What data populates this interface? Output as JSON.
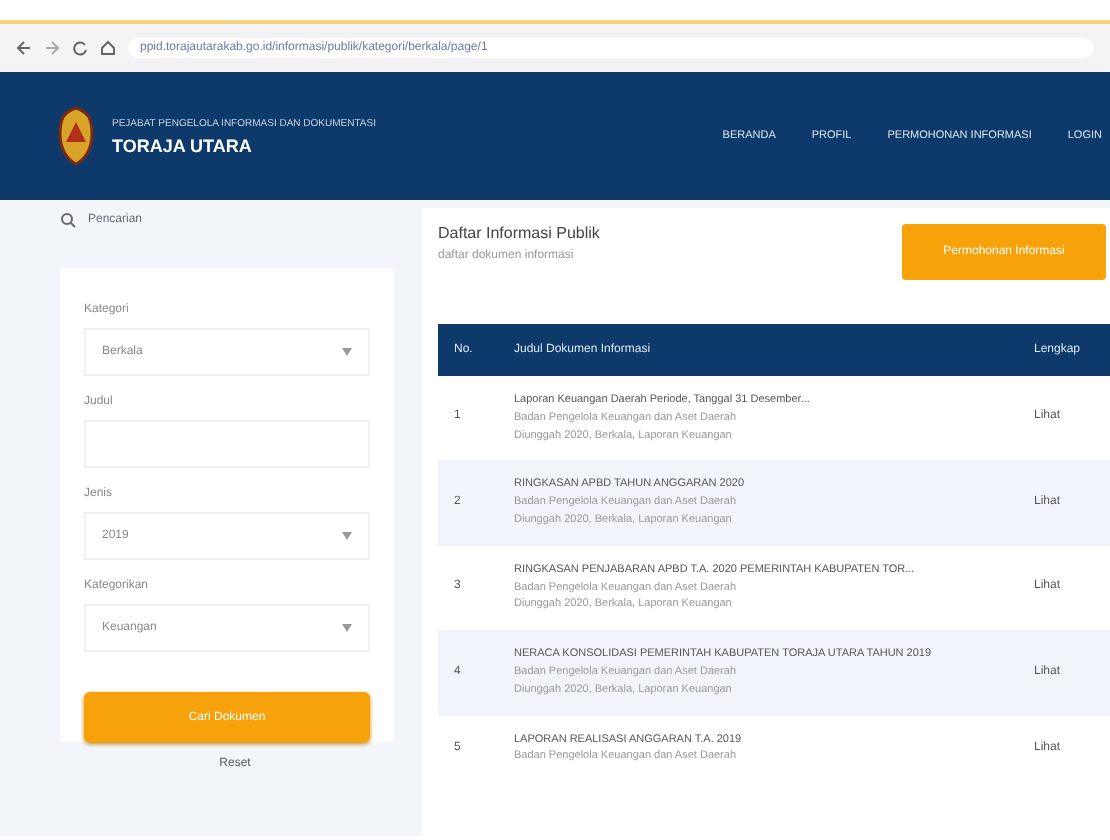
{
  "browser": {
    "url": "ppid.torajautarakab.go.id/informasi/publik/kategori/berkala/page/1"
  },
  "header": {
    "subtitle": "PEJABAT PENGELOLA INFORMASI DAN DOKUMENTASI",
    "title": "TORAJA UTARA",
    "nav": [
      "BERANDA",
      "PROFIL",
      "PERMOHONAN INFORMASI",
      "LOGIN"
    ]
  },
  "sidebar": {
    "heading": "Pencarian",
    "fields": [
      {
        "kind": "select",
        "label": "Kategori",
        "value": "Berkala"
      },
      {
        "kind": "text",
        "label": "Judul"
      },
      {
        "kind": "select",
        "label": "Jenis",
        "value": "2019"
      },
      {
        "kind": "select",
        "label": "Kategorikan",
        "value": "Keuangan"
      }
    ],
    "button": "Cari Dokumen",
    "reset": "Reset"
  },
  "main": {
    "title": "Daftar Informasi Publik",
    "subtitle": "daftar dokumen informasi",
    "button": "Permohonan Informasi",
    "table": {
      "columns": [
        "No.",
        "Judul Dokumen Informasi",
        "Lengkap"
      ],
      "rows": [
        {
          "no": "1",
          "title": "Laporan Keuangan Daerah Periode, Tanggal 31 Desember...",
          "lines": [
            "Badan Pengelola Keuangan dan Aset Daerah",
            "Diunggah 2020, Berkala, Laporan Keuangan"
          ],
          "action": "Lihat"
        },
        {
          "no": "2",
          "title": "RINGKASAN APBD TAHUN ANGGARAN 2020",
          "lines": [
            "Badan Pengelola Keuangan dan Aset Daerah",
            "Diunggah 2020, Berkala, Laporan Keuangan"
          ],
          "action": "Lihat"
        },
        {
          "no": "3",
          "title": "RINGKASAN PENJABARAN APBD T.A. 2020 PEMERINTAH KABUPATEN TOR...",
          "lines": [
            "Badan Pengelola Keuangan dan Aset Daerah",
            "Diunggah 2020, Berkala, Laporan Keuangan"
          ],
          "action": "Lihat"
        },
        {
          "no": "4",
          "title": "NERACA KONSOLIDASI PEMERINTAH KABUPATEN TORAJA UTARA TAHUN 2019",
          "lines": [
            "Badan Pengelola Keuangan dan Aset Daerah",
            "Diunggah 2020, Berkala, Laporan Keuangan"
          ],
          "action": "Lihat"
        },
        {
          "no": "5",
          "title": "LAPORAN REALISASI ANGGARAN T.A. 2019",
          "lines": [
            "Badan Pengelola Keuangan dan Aset Daerah"
          ],
          "action": "Lihat"
        }
      ]
    }
  }
}
